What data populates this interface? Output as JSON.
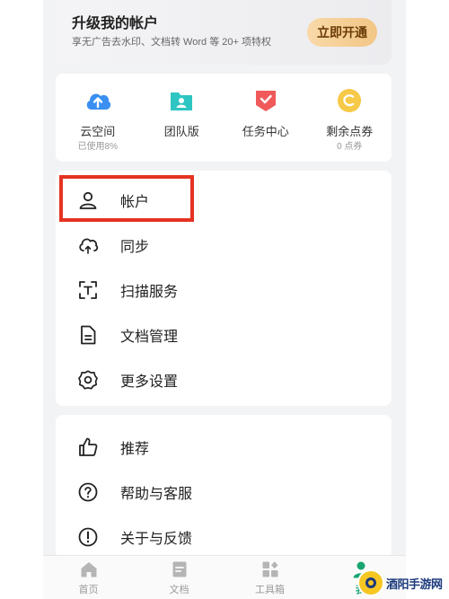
{
  "banner": {
    "title": "升级我的帐户",
    "subtitle": "享无广告去水印、文档转 Word 等 20+ 项特权",
    "button": "立即开通"
  },
  "quick": [
    {
      "label": "云空间",
      "sub": "已使用8%",
      "icon": "cloud-upload-icon",
      "color": "#3a8ff0"
    },
    {
      "label": "团队版",
      "sub": "",
      "icon": "team-folder-icon",
      "color": "#2ec5c2"
    },
    {
      "label": "任务中心",
      "sub": "",
      "icon": "task-center-icon",
      "color": "#f05a5a"
    },
    {
      "label": "剩余点券",
      "sub": "0 点券",
      "icon": "coupon-coin-icon",
      "color": "#f7c948"
    }
  ],
  "menu1": [
    {
      "label": "帐户",
      "icon": "person-icon"
    },
    {
      "label": "同步",
      "icon": "cloud-sync-icon"
    },
    {
      "label": "扫描服务",
      "icon": "scan-text-icon"
    },
    {
      "label": "文档管理",
      "icon": "document-icon"
    },
    {
      "label": "更多设置",
      "icon": "gear-icon"
    }
  ],
  "menu2": [
    {
      "label": "推荐",
      "icon": "thumbs-up-icon"
    },
    {
      "label": "帮助与客服",
      "icon": "help-icon"
    },
    {
      "label": "关于与反馈",
      "icon": "info-icon"
    }
  ],
  "nav": [
    {
      "label": "首页",
      "icon": "home-icon"
    },
    {
      "label": "文档",
      "icon": "document-nav-icon"
    },
    {
      "label": "工具箱",
      "icon": "toolbox-icon"
    },
    {
      "label": "我",
      "icon": "profile-nav-icon",
      "active": true
    }
  ],
  "watermark": {
    "text": "酒阳手游网"
  },
  "colors": {
    "accent": "#18a571",
    "highlight": "#e53322",
    "vip_gold": "#f2c685"
  }
}
